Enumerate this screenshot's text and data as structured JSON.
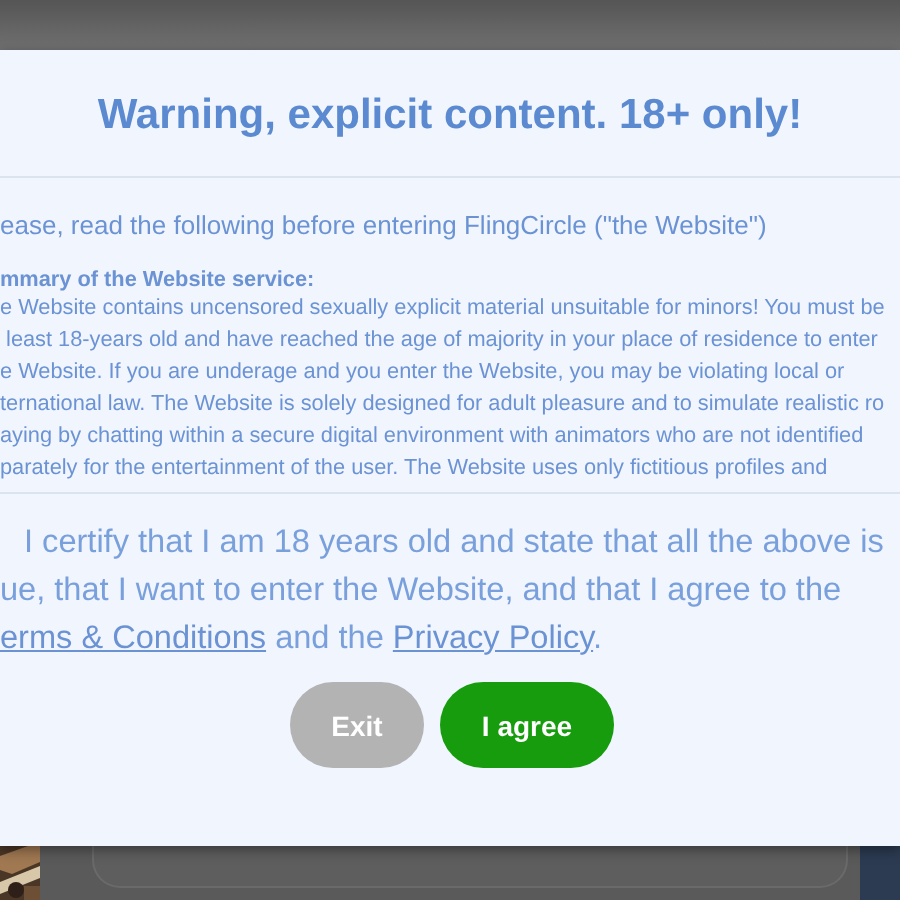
{
  "title": "Warning, explicit content. 18+ only!",
  "intro": "ease, read the following before entering FlingCircle (\"the Website\")",
  "summary": {
    "heading": "mmary of the Website service:",
    "lines": [
      "e Website contains uncensored sexually explicit material unsuitable for minors! You must be",
      " least 18-years old and have reached the age of majority in your place of residence to enter",
      "e Website. If you are underage and you enter the Website, you may be violating local or",
      "ternational law. The Website is solely designed for adult pleasure and to simulate realistic ro",
      "aying by chatting within a secure digital environment with animators who are not identified",
      "parately for the entertainment of the user. The Website uses only fictitious profiles and"
    ]
  },
  "certify": {
    "lines": [
      "I certify that I am 18 years old and state that all the above is",
      "ue, that I want to enter the Website, and that I agree to the"
    ],
    "terms_link": "erms & Conditions",
    "middle": "and the",
    "privacy_link": "Privacy Policy",
    "end": "."
  },
  "buttons": [
    {
      "label": "Exit",
      "kind": "secondary"
    },
    {
      "label": "I agree",
      "kind": "primary"
    }
  ]
}
